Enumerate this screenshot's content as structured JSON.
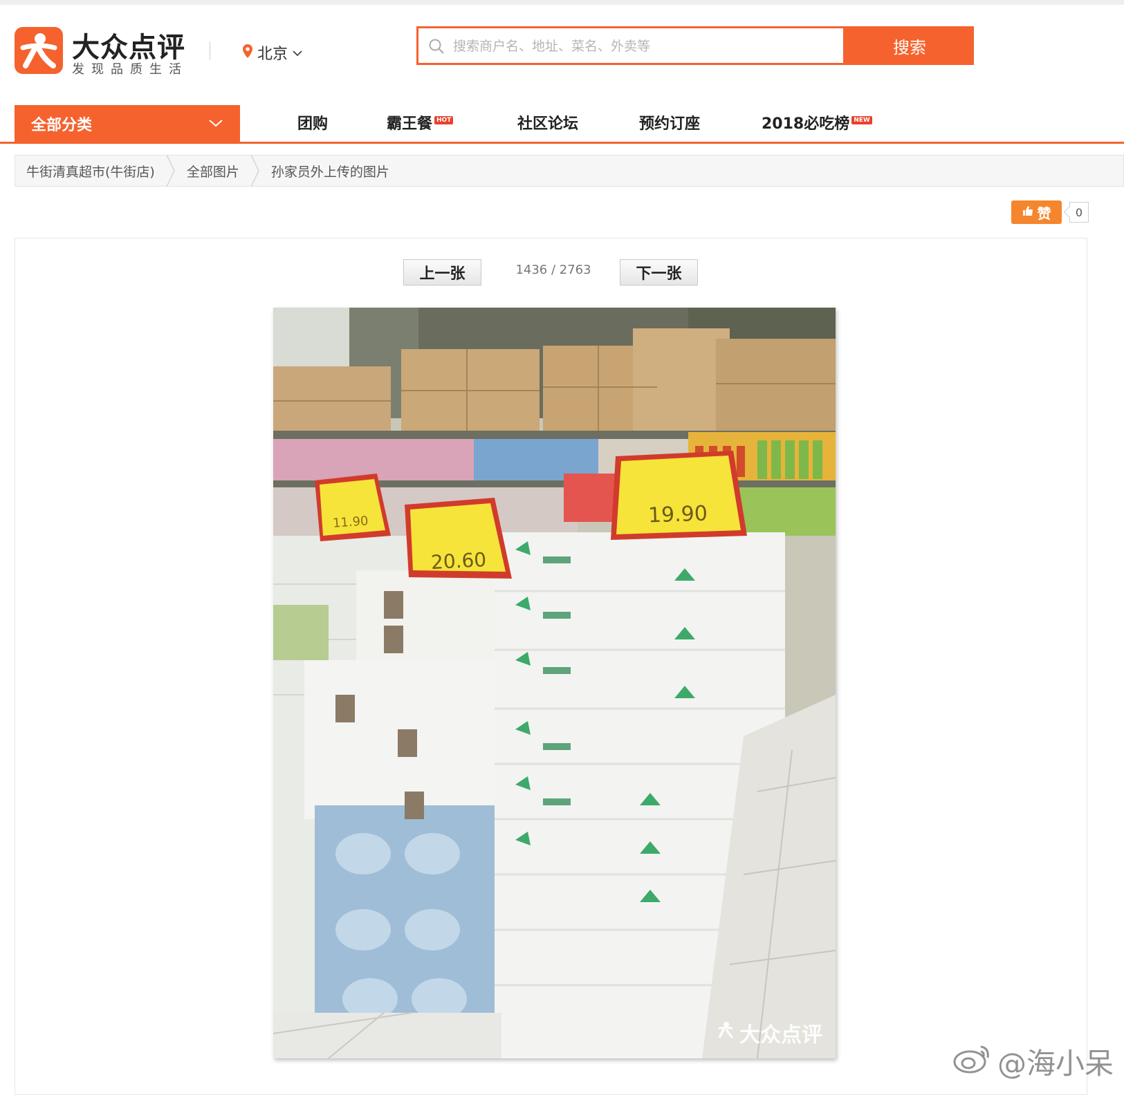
{
  "brand": {
    "name": "大众点评",
    "slogan": "发现品质生活",
    "accent_color": "#f5622d"
  },
  "location": {
    "city": "北京",
    "icon": "location-pin-icon"
  },
  "search": {
    "placeholder": "搜索商户名、地址、菜名、外卖等",
    "button_label": "搜索"
  },
  "nav": {
    "category_label": "全部分类",
    "items": [
      {
        "label": "团购",
        "badge": ""
      },
      {
        "label": "霸王餐",
        "badge": "HOT"
      },
      {
        "label": "社区论坛",
        "badge": ""
      },
      {
        "label": "预约订座",
        "badge": ""
      },
      {
        "label": "2018必吃榜",
        "badge": "NEW"
      }
    ]
  },
  "breadcrumb": [
    "牛街清真超市(牛街店)",
    "全部图片",
    "孙家员外上传的图片"
  ],
  "like": {
    "label": "赞",
    "count": "0"
  },
  "viewer": {
    "prev_label": "上一张",
    "next_label": "下一张",
    "counter": "1436 / 2763",
    "price_tags": [
      "11.90",
      "20.60",
      "19.90"
    ],
    "watermark": "大众点评"
  },
  "weibo_watermark": "@海小呆"
}
